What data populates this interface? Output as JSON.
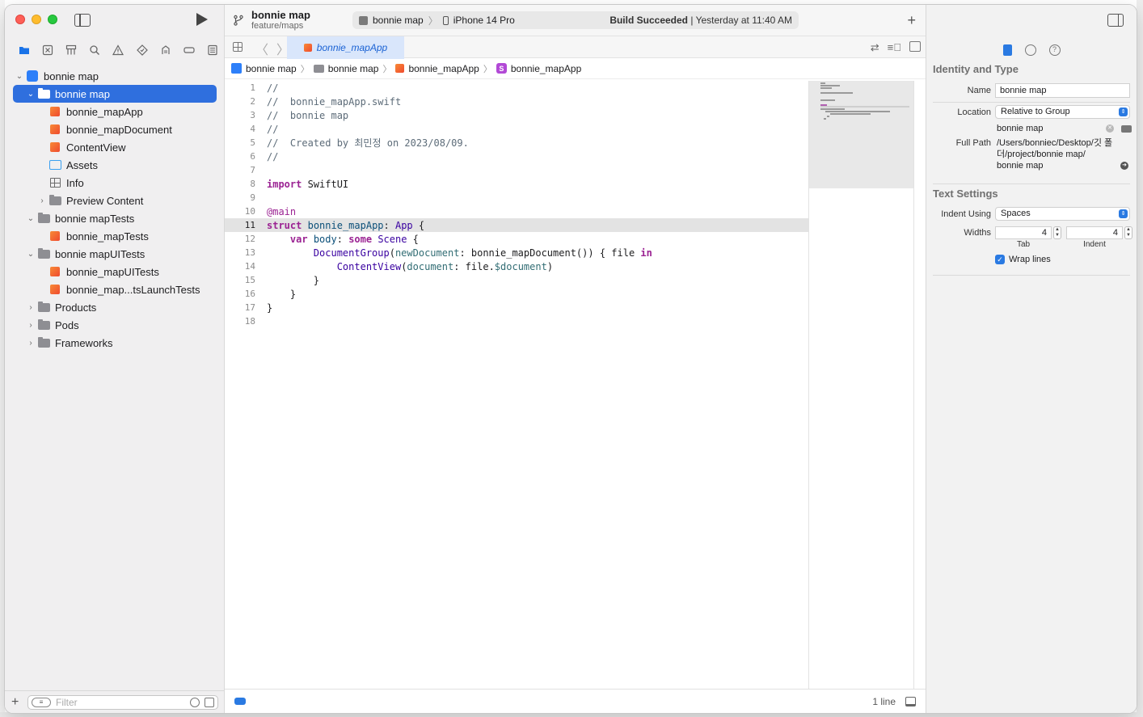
{
  "navigator": {
    "tabs": [
      "folder-icon",
      "x-box-icon",
      "hierarchy-icon",
      "search-icon",
      "warning-icon",
      "diamond-icon",
      "test-icon",
      "tag-icon",
      "list-icon"
    ],
    "tree": [
      {
        "label": "bonnie map",
        "type": "project",
        "depth": 0,
        "chev": "open"
      },
      {
        "label": "bonnie map",
        "type": "folder",
        "depth": 1,
        "chev": "open",
        "selected": true
      },
      {
        "label": "bonnie_mapApp",
        "type": "swift",
        "depth": 2
      },
      {
        "label": "bonnie_mapDocument",
        "type": "swift",
        "depth": 2
      },
      {
        "label": "ContentView",
        "type": "swift",
        "depth": 2
      },
      {
        "label": "Assets",
        "type": "assets",
        "depth": 2
      },
      {
        "label": "Info",
        "type": "info",
        "depth": 2
      },
      {
        "label": "Preview Content",
        "type": "folder",
        "depth": 2,
        "chev": "closed"
      },
      {
        "label": "bonnie mapTests",
        "type": "folder",
        "depth": 1,
        "chev": "open"
      },
      {
        "label": "bonnie_mapTests",
        "type": "swift",
        "depth": 2
      },
      {
        "label": "bonnie mapUITests",
        "type": "folder",
        "depth": 1,
        "chev": "open"
      },
      {
        "label": "bonnie_mapUITests",
        "type": "swift",
        "depth": 2
      },
      {
        "label": "bonnie_map...tsLaunchTests",
        "type": "swift",
        "depth": 2
      },
      {
        "label": "Products",
        "type": "folder",
        "depth": 1,
        "chev": "closed"
      },
      {
        "label": "Pods",
        "type": "folder",
        "depth": 1,
        "chev": "closed"
      },
      {
        "label": "Frameworks",
        "type": "folder",
        "depth": 1,
        "chev": "closed"
      }
    ],
    "filter_placeholder": "Filter"
  },
  "toolbar": {
    "project_name": "bonnie map",
    "branch": "feature/maps",
    "scheme": "bonnie map",
    "device": "iPhone 14 Pro",
    "status_bold": "Build Succeeded",
    "status_rest": " | Yesterday at 11:40 AM"
  },
  "tab": {
    "file": "bonnie_mapApp"
  },
  "breadcrumb": [
    "bonnie map",
    "bonnie map",
    "bonnie_mapApp",
    "bonnie_mapApp"
  ],
  "code": {
    "current_line": 11,
    "lines": [
      "//",
      "//  bonnie_mapApp.swift",
      "//  bonnie map",
      "//",
      "//  Created by 최민정 on 2023/08/09.",
      "//",
      "",
      "import SwiftUI",
      "",
      "@main",
      "struct bonnie_mapApp: App {",
      "    var body: some Scene {",
      "        DocumentGroup(newDocument: bonnie_mapDocument()) { file in",
      "            ContentView(document: file.$document)",
      "        }",
      "    }",
      "}",
      ""
    ]
  },
  "status_bar": {
    "lines": "1 line"
  },
  "inspector": {
    "identity_title": "Identity and Type",
    "name_label": "Name",
    "name_value": "bonnie map",
    "location_label": "Location",
    "location_value": "Relative to Group",
    "location_name": "bonnie map",
    "fullpath_label": "Full Path",
    "fullpath_value": "/Users/bonniec/Desktop/깃 폴더/project/bonnie map/",
    "fullpath_tail": "bonnie map",
    "text_title": "Text Settings",
    "indent_label": "Indent Using",
    "indent_value": "Spaces",
    "widths_label": "Widths",
    "tab_width": "4",
    "indent_width": "4",
    "tab_caption": "Tab",
    "indent_caption": "Indent",
    "wrap_label": "Wrap lines"
  }
}
